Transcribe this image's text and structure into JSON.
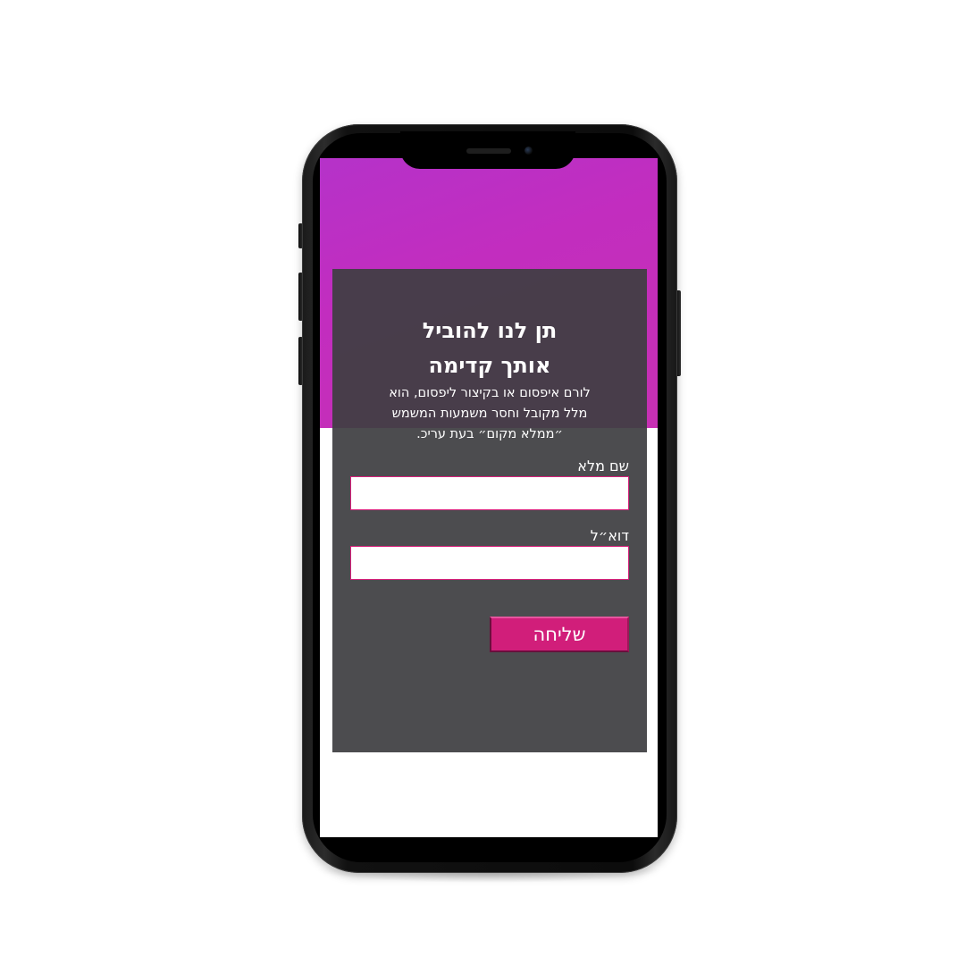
{
  "device": {
    "frame_color": "#111111",
    "screen_hero_color": "#c22dbf"
  },
  "form": {
    "title_line1": "תן לנו להוביל",
    "title_line2": "אותך קדימה",
    "description_line1": "לורם איפסום או בקיצור ליפסום, הוא",
    "description_line2": "מלל מקובל וחסר משמעות המשמש",
    "description_line3": "״ממלא מקום״ בעת עריכ.",
    "name_label": "שם מלא",
    "name_value": "",
    "email_label": "דוא״ל",
    "email_value": "",
    "submit_label": "שליחה",
    "accent_color": "#d11e7a",
    "card_color": "#3e3e42"
  }
}
